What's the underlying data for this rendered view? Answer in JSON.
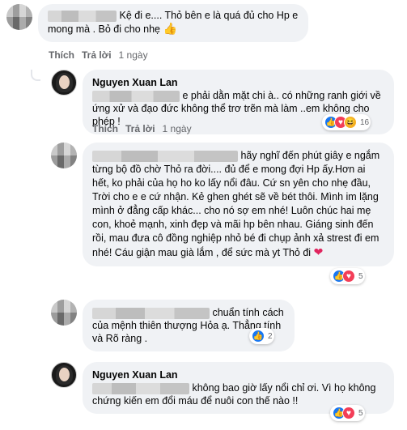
{
  "comments": [
    {
      "author": "",
      "text": "Kệ đi e.... Thỏ bên e là quá đủ cho Hp e mong mà . Bỏ đi cho nhẹ",
      "emoji": "👍",
      "actions": {
        "like": "Thích",
        "reply": "Trả lời",
        "time": "1 ngày"
      }
    },
    {
      "author": "Nguyen Xuan Lan",
      "text": "e phải dằn mặt chi à.. có những ranh giới về ứng xử và đạo đức không thể trơ trẽn mà làm ..em không cho phép !",
      "actions": {
        "like": "Thích",
        "reply": "Trả lời",
        "time": "1 ngày"
      },
      "reactions": {
        "icons": [
          "like-icon",
          "love-icon",
          "haha-icon"
        ],
        "count": "16"
      }
    },
    {
      "author": "",
      "text": "hãy nghĩ đến phút giây e ngắm từng bộ đồ chờ Thỏ ra đời.... đủ để e mong đợi Hp ấy.Hơn ai hết, ko phải của họ ho ko lấy nổi đâu. Cứ sn yên cho nhẹ đầu, Trời cho e e cứ nhận. Kẻ ghen ghét sẽ về bét thôi. Mình im lặng mình ở đẳng cấp khác... cho nó sợ em nhé! Luôn chúc hai mẹ con, khoẻ mạnh, xinh đẹp và mãi hp bên nhau. Giáng sinh đến rồi, mau đưa cô đồng nghiệp nhỏ bé đi chụp ảnh xả strest đi em nhé! Cáu giận mau già lắm , để sức mà yt Thỏ đi",
      "emoji": "❤",
      "reactions": {
        "icons": [
          "like-icon",
          "love-icon"
        ],
        "count": "5"
      }
    },
    {
      "author": "",
      "text": "chuẩn tính cách của mệnh thiên thượng Hỏa ạ. Thẳng tính và Rõ ràng .",
      "reactions": {
        "icons": [
          "like-icon"
        ],
        "count": "2"
      }
    },
    {
      "author": "Nguyen Xuan Lan",
      "text": "không bao giờ lấy nổi chỉ ơi. Vì họ không chứng kiến em đổi máu để nuôi con thế nào !!",
      "reactions": {
        "icons": [
          "like-icon",
          "love-icon"
        ],
        "count": "5"
      }
    }
  ],
  "colors": {
    "bubble": "#f0f2f5",
    "meta": "#65676b",
    "like": "#1877f2",
    "love": "#f33e58",
    "haha": "#f7b125"
  }
}
